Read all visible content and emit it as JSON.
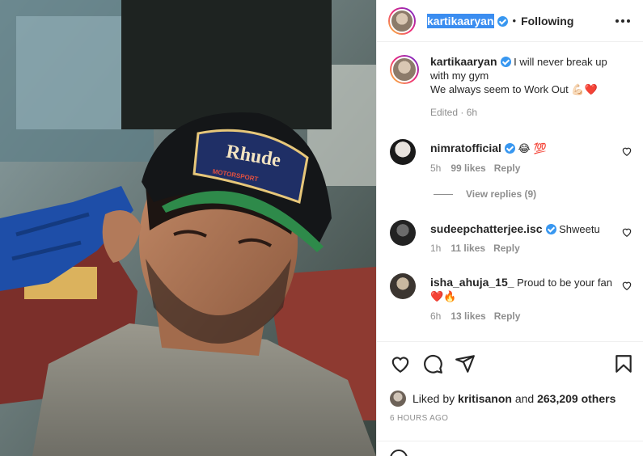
{
  "header": {
    "username": "kartikaaryan",
    "separator": "•",
    "follow_label": "Following"
  },
  "caption": {
    "username": "kartikaaryan",
    "line1": "I will never break up",
    "line2": "with my gym",
    "line3": "We always seem to Work Out",
    "emoji": "💪🏻❤️",
    "meta": "Edited · 6h"
  },
  "comments": [
    {
      "username": "nimratofficial",
      "verified": true,
      "text": "😂 💯",
      "time": "5h",
      "likes": "99 likes",
      "reply": "Reply"
    },
    {
      "username": "sudeepchatterjee.isc",
      "verified": true,
      "text": "Shweetu",
      "time": "1h",
      "likes": "11 likes",
      "reply": "Reply"
    },
    {
      "username": "isha_ahuja_15_",
      "verified": false,
      "text": "Proud to be your fan",
      "text2": "❤️🔥",
      "time": "6h",
      "likes": "13 likes",
      "reply": "Reply"
    }
  ],
  "view_replies": "View replies (9)",
  "likes_line": {
    "prefix": "Liked by",
    "user": "kritisanon",
    "mid": "and",
    "count": "263,209 others"
  },
  "timestamp": "6 HOURS AGO",
  "photo": {
    "cap_text_1": "Rhude",
    "cap_text_2": "MOTORSPORT"
  },
  "colors": {
    "verified": "#3897f0",
    "heart": "#ed4956",
    "selection": "#3b8df0"
  },
  "icons": [
    "heart-icon",
    "comment-icon",
    "share-icon",
    "bookmark-icon",
    "more-icon",
    "verified-icon",
    "emoji-icon"
  ]
}
